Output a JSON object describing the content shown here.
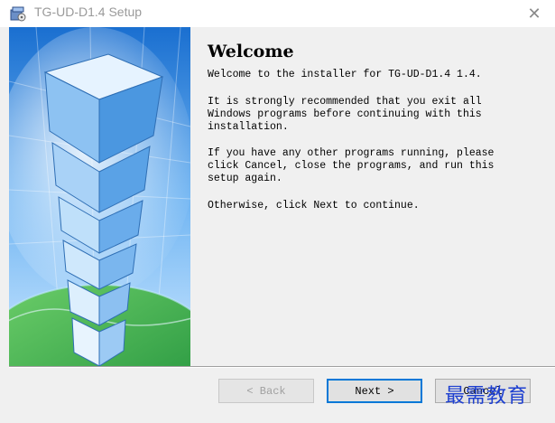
{
  "window": {
    "title": "TG-UD-D1.4 Setup",
    "close_glyph": "✕"
  },
  "welcome": {
    "heading": "Welcome",
    "line1": "Welcome to the installer for TG-UD-D1.4 1.4.",
    "para2": "It is strongly recommended that you exit all\nWindows programs before continuing with this\ninstallation.",
    "para3": "If you have any other programs running, please\nclick Cancel, close the programs, and run this\nsetup again.",
    "para4": "Otherwise, click Next to continue."
  },
  "buttons": {
    "back_label": "< Back",
    "next_label": "Next >",
    "cancel_label": "Cancel"
  },
  "watermark": "最需教育",
  "colors": {
    "accent": "#0078d7",
    "banner_sky": "#2f8fe0",
    "globe_green": "#3cb43c"
  },
  "icons": {
    "app": "installer-icon",
    "close": "close-icon"
  }
}
